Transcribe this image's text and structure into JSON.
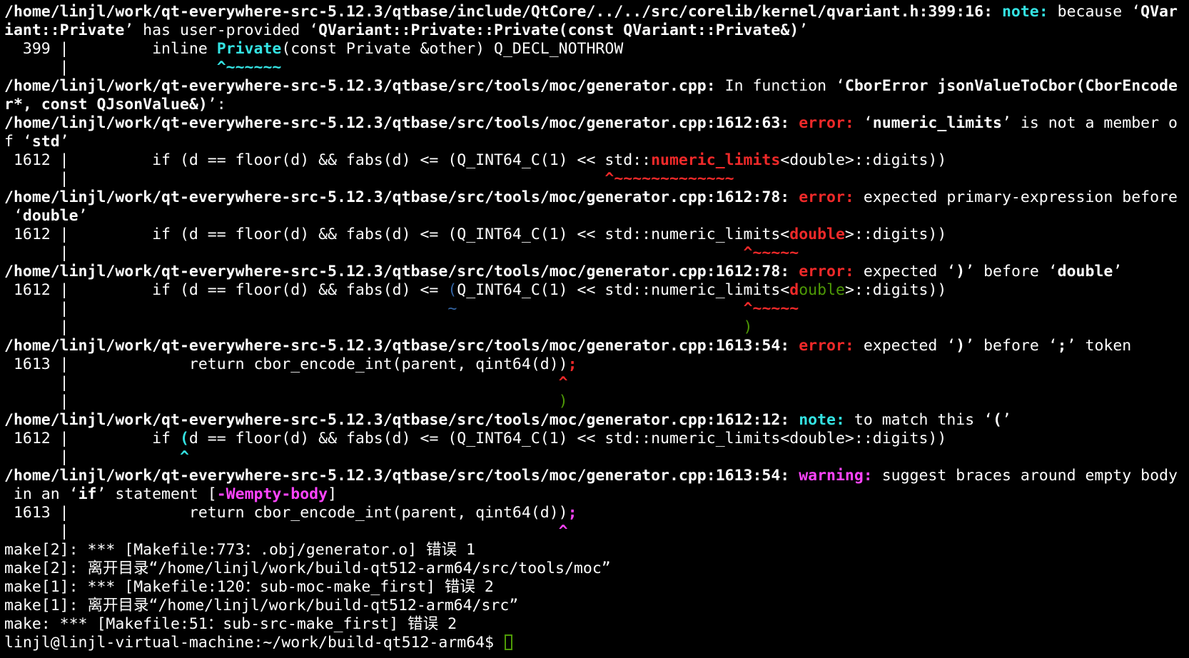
{
  "lines": [
    [
      [
        "/home/linjl/work/qt-everywhere-src-5.12.3/qtbase/include/QtCore/../../src/corelib/kernel/qvariant.h:399:16: ",
        "b"
      ],
      [
        "note:",
        "b cyan"
      ],
      [
        " because ‘",
        ""
      ],
      [
        "QVar",
        "b"
      ]
    ],
    [
      [
        "iant::Private",
        "b"
      ],
      [
        "’ has user-provided ‘",
        ""
      ],
      [
        "QVariant::Private::Private(const QVariant::Private&)",
        "b"
      ],
      [
        "’",
        ""
      ]
    ],
    [
      [
        "  399 |         inline ",
        ""
      ],
      [
        "Private",
        "b cyan"
      ],
      [
        "(const Private &other) Q_DECL_NOTHROW",
        ""
      ]
    ],
    [
      [
        "      |                ",
        ""
      ],
      [
        "^~~~~~~",
        "b cyan"
      ]
    ],
    [
      [
        "/home/linjl/work/qt-everywhere-src-5.12.3/qtbase/src/tools/moc/generator.cpp:",
        "b"
      ],
      [
        " In function ‘",
        ""
      ],
      [
        "CborError jsonValueToCbor(CborEncode",
        "b"
      ]
    ],
    [
      [
        "r*, const QJsonValue&)",
        "b"
      ],
      [
        "’:",
        ""
      ]
    ],
    [
      [
        "/home/linjl/work/qt-everywhere-src-5.12.3/qtbase/src/tools/moc/generator.cpp:1612:63: ",
        "b"
      ],
      [
        "error:",
        "b red"
      ],
      [
        " ‘",
        ""
      ],
      [
        "numeric_limits",
        "b"
      ],
      [
        "’ is not a member o",
        ""
      ]
    ],
    [
      [
        "f ‘",
        ""
      ],
      [
        "std",
        "b"
      ],
      [
        "’",
        ""
      ]
    ],
    [
      [
        " 1612 |         if (d == floor(d) && fabs(d) <= (Q_INT64_C(1) << std::",
        ""
      ],
      [
        "numeric_limits",
        "b red"
      ],
      [
        "<double>::digits))",
        ""
      ]
    ],
    [
      [
        "      |                                                          ",
        ""
      ],
      [
        "^~~~~~~~~~~~~~",
        "b red"
      ]
    ],
    [
      [
        "/home/linjl/work/qt-everywhere-src-5.12.3/qtbase/src/tools/moc/generator.cpp:1612:78: ",
        "b"
      ],
      [
        "error:",
        "b red"
      ],
      [
        " expected primary-expression before",
        ""
      ]
    ],
    [
      [
        " ‘",
        ""
      ],
      [
        "double",
        "b"
      ],
      [
        "’",
        ""
      ]
    ],
    [
      [
        " 1612 |         if (d == floor(d) && fabs(d) <= (Q_INT64_C(1) << std::numeric_limits<",
        ""
      ],
      [
        "double",
        "b red"
      ],
      [
        ">::digits))",
        ""
      ]
    ],
    [
      [
        "      |                                                                         ",
        ""
      ],
      [
        "^~~~~~",
        "b red"
      ]
    ],
    [
      [
        "/home/linjl/work/qt-everywhere-src-5.12.3/qtbase/src/tools/moc/generator.cpp:1612:78: ",
        "b"
      ],
      [
        "error:",
        "b red"
      ],
      [
        " expected ‘",
        ""
      ],
      [
        ")",
        "b"
      ],
      [
        "’ before ‘",
        ""
      ],
      [
        "double",
        "b"
      ],
      [
        "’",
        ""
      ]
    ],
    [
      [
        " 1612 |         if (d == floor(d) && fabs(d) <= ",
        ""
      ],
      [
        "(",
        "blue"
      ],
      [
        "Q_INT64_C(1) << std::numeric_limits<",
        ""
      ],
      [
        "d",
        "b red"
      ],
      [
        "ouble",
        "green"
      ],
      [
        ">::digits))",
        ""
      ]
    ],
    [
      [
        "      |                                         ",
        ""
      ],
      [
        "~",
        "blue"
      ],
      [
        "                               ",
        ""
      ],
      [
        "^~~~~~",
        "b red"
      ]
    ],
    [
      [
        "      |                                                                         ",
        ""
      ],
      [
        ")",
        "green"
      ]
    ],
    [
      [
        "/home/linjl/work/qt-everywhere-src-5.12.3/qtbase/src/tools/moc/generator.cpp:1613:54: ",
        "b"
      ],
      [
        "error:",
        "b red"
      ],
      [
        " expected ‘",
        ""
      ],
      [
        ")",
        "b"
      ],
      [
        "’ before ‘",
        ""
      ],
      [
        ";",
        "b"
      ],
      [
        "’ token",
        ""
      ]
    ],
    [
      [
        " 1613 |             return cbor_encode_int(parent, qint64(d))",
        ""
      ],
      [
        ";",
        "b red"
      ]
    ],
    [
      [
        "      |                                                     ",
        ""
      ],
      [
        "^",
        "b red"
      ]
    ],
    [
      [
        "      |                                                     ",
        ""
      ],
      [
        ")",
        "green"
      ]
    ],
    [
      [
        "/home/linjl/work/qt-everywhere-src-5.12.3/qtbase/src/tools/moc/generator.cpp:1612:12: ",
        "b"
      ],
      [
        "note:",
        "b cyan"
      ],
      [
        " to match this ‘",
        ""
      ],
      [
        "(",
        "b"
      ],
      [
        "’",
        ""
      ]
    ],
    [
      [
        " 1612 |         if ",
        ""
      ],
      [
        "(",
        "b cyan"
      ],
      [
        "d == floor(d) && fabs(d) <= (Q_INT64_C(1) << std::numeric_limits<double>::digits))",
        ""
      ]
    ],
    [
      [
        "      |            ",
        ""
      ],
      [
        "^",
        "b cyan"
      ]
    ],
    [
      [
        "/home/linjl/work/qt-everywhere-src-5.12.3/qtbase/src/tools/moc/generator.cpp:1613:54: ",
        "b"
      ],
      [
        "warning:",
        "b magenta"
      ],
      [
        " suggest braces around empty body",
        ""
      ]
    ],
    [
      [
        " in an ‘",
        ""
      ],
      [
        "if",
        "b"
      ],
      [
        "’ statement [",
        ""
      ],
      [
        "-Wempty-body",
        "b magenta"
      ],
      [
        "]",
        ""
      ]
    ],
    [
      [
        " 1613 |             return cbor_encode_int(parent, qint64(d))",
        ""
      ],
      [
        ";",
        "b magenta"
      ]
    ],
    [
      [
        "      |                                                     ",
        ""
      ],
      [
        "^",
        "b magenta"
      ]
    ],
    [
      [
        "make[2]: *** [Makefile:773：.obj/generator.o] 错误 1",
        ""
      ]
    ],
    [
      [
        "make[2]: 离开目录“/home/linjl/work/build-qt512-arm64/src/tools/moc”",
        ""
      ]
    ],
    [
      [
        "make[1]: *** [Makefile:120：sub-moc-make_first] 错误 2",
        ""
      ]
    ],
    [
      [
        "make[1]: 离开目录“/home/linjl/work/build-qt512-arm64/src”",
        ""
      ]
    ],
    [
      [
        "make: *** [Makefile:51：sub-src-make_first] 错误 2",
        ""
      ]
    ]
  ],
  "prompt": "linjl@linjl-virtual-machine:~/work/build-qt512-arm64$ ",
  "colors": {
    "background": "#000000",
    "foreground": "#ffffff",
    "note": "#34e2e2",
    "error": "#ef2929",
    "warning": "#ff44ff",
    "fixit": "#4e9a06",
    "range": "#3465a4"
  }
}
